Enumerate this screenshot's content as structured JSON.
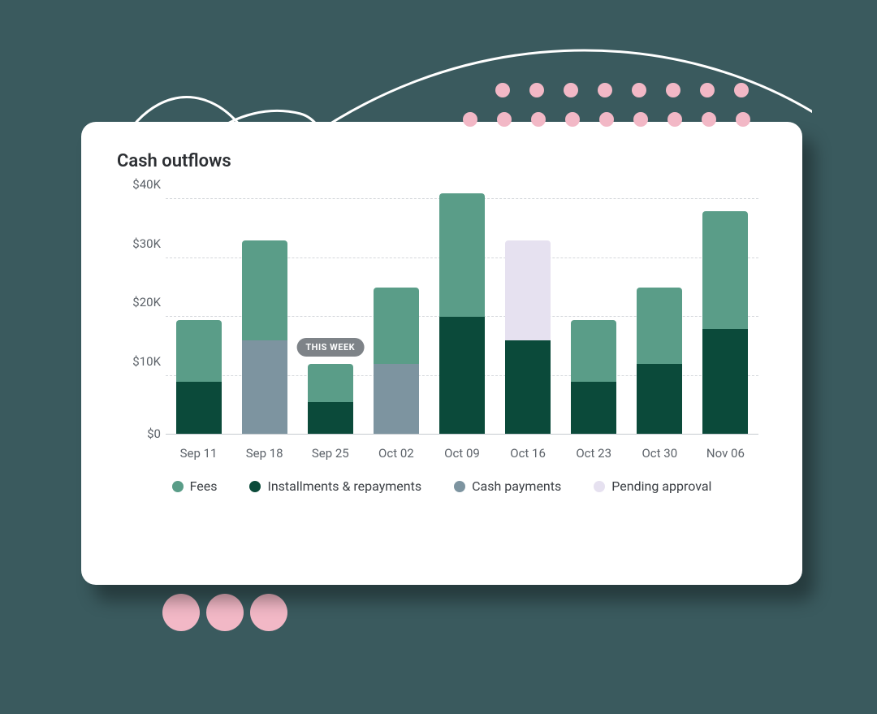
{
  "title": "Cash outflows",
  "badge_label": "THIS WEEK",
  "colors": {
    "fees": "#5a9d88",
    "installments": "#0b4a3a",
    "cash": "#7d94a0",
    "pending": "#e6e1f0"
  },
  "y_ticks": [
    "$0",
    "$10K",
    "$20K",
    "$30K",
    "$40K"
  ],
  "legend": [
    {
      "key": "fees",
      "label": "Fees"
    },
    {
      "key": "installments",
      "label": "Installments & repayments"
    },
    {
      "key": "cash",
      "label": "Cash payments"
    },
    {
      "key": "pending",
      "label": "Pending approval"
    }
  ],
  "chart_data": {
    "type": "bar",
    "stacked": true,
    "title": "Cash outflows",
    "xlabel": "",
    "ylabel": "",
    "ylim": [
      0,
      40000
    ],
    "y_format": "$,K",
    "categories": [
      "Sep 11",
      "Sep 18",
      "Sep 25",
      "Oct 02",
      "Oct 09",
      "Oct 16",
      "Oct 23",
      "Oct 30",
      "Nov 06"
    ],
    "series": [
      {
        "name": "Installments & repayments",
        "color_key": "installments",
        "values": [
          9000,
          0,
          5500,
          0,
          20000,
          16000,
          9000,
          12000,
          18000
        ]
      },
      {
        "name": "Cash payments",
        "color_key": "cash",
        "values": [
          0,
          16000,
          0,
          12000,
          0,
          0,
          0,
          0,
          0
        ]
      },
      {
        "name": "Fees",
        "color_key": "fees",
        "values": [
          10500,
          17000,
          6500,
          13000,
          21000,
          0,
          10500,
          13000,
          20000
        ]
      },
      {
        "name": "Pending approval",
        "color_key": "pending",
        "values": [
          0,
          0,
          0,
          0,
          0,
          17000,
          0,
          0,
          0
        ]
      }
    ],
    "highlight": {
      "category": "Sep 25",
      "label": "THIS WEEK"
    }
  }
}
